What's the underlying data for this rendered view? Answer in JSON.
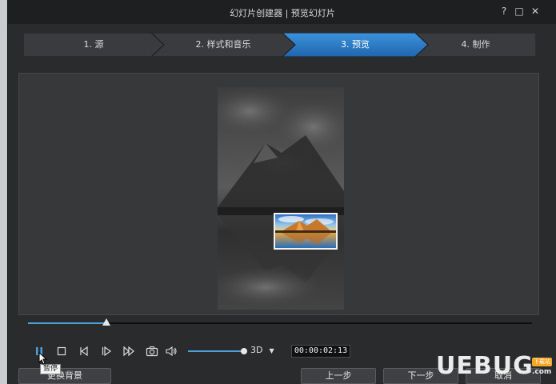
{
  "window": {
    "title": "幻灯片创建器 | 预览幻灯片",
    "help_label": "?",
    "maximize_label": "□",
    "close_label": "✕"
  },
  "steps": [
    {
      "label": "1. 源",
      "active": false
    },
    {
      "label": "2. 样式和音乐",
      "active": false
    },
    {
      "label": "3. 预览",
      "active": true
    },
    {
      "label": "4. 制作",
      "active": false
    }
  ],
  "player": {
    "progress": 0.155,
    "volume": 1.0,
    "mode": "3D",
    "timecode": "00:00:02:13",
    "tooltip": "暂停",
    "icons": [
      "pause-icon",
      "stop-icon",
      "previous-frame-icon",
      "play-icon",
      "next-frame-icon",
      "camera-icon",
      "volume-icon"
    ]
  },
  "buttons": {
    "background": "更换背景",
    "previous": "上一步",
    "next": "下一步",
    "cancel": "取消"
  },
  "watermark": {
    "logo": "UEBUG",
    "badge": "下载站",
    "url": ".com"
  },
  "colors": {
    "accent": "#2f7fc8",
    "progress": "#4ea0d6",
    "background": "#2a2b2d"
  }
}
